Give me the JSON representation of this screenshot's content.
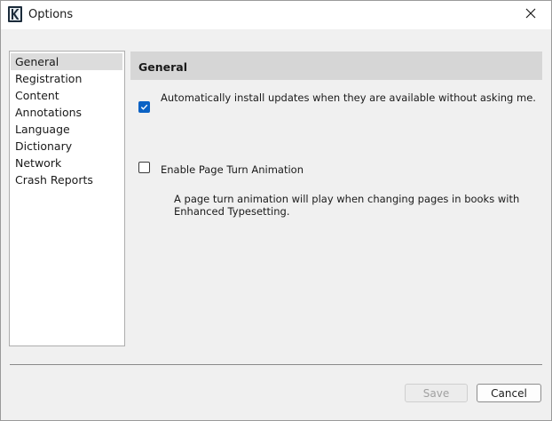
{
  "window": {
    "title": "Options",
    "icons": {
      "app": "kindle-app-icon",
      "close": "close-icon"
    }
  },
  "sidebar": {
    "items": [
      {
        "label": "General",
        "selected": true
      },
      {
        "label": "Registration",
        "selected": false
      },
      {
        "label": "Content",
        "selected": false
      },
      {
        "label": "Annotations",
        "selected": false
      },
      {
        "label": "Language",
        "selected": false
      },
      {
        "label": "Dictionary",
        "selected": false
      },
      {
        "label": "Network",
        "selected": false
      },
      {
        "label": "Crash Reports",
        "selected": false
      }
    ]
  },
  "panel": {
    "title": "General",
    "auto_update": {
      "label": "Automatically install updates when they are available without asking me.",
      "checked": true
    },
    "page_turn": {
      "label": "Enable Page Turn Animation",
      "checked": false,
      "description": "A page turn animation will play when changing pages in books with Enhanced Typesetting."
    }
  },
  "buttons": {
    "save": {
      "label": "Save",
      "enabled": false
    },
    "cancel": {
      "label": "Cancel",
      "enabled": true
    }
  },
  "colors": {
    "accent": "#0b62c4",
    "header_bg": "#d6d6d6",
    "selection_bg": "#dcdcdc",
    "window_bg": "#f0f0f0"
  }
}
